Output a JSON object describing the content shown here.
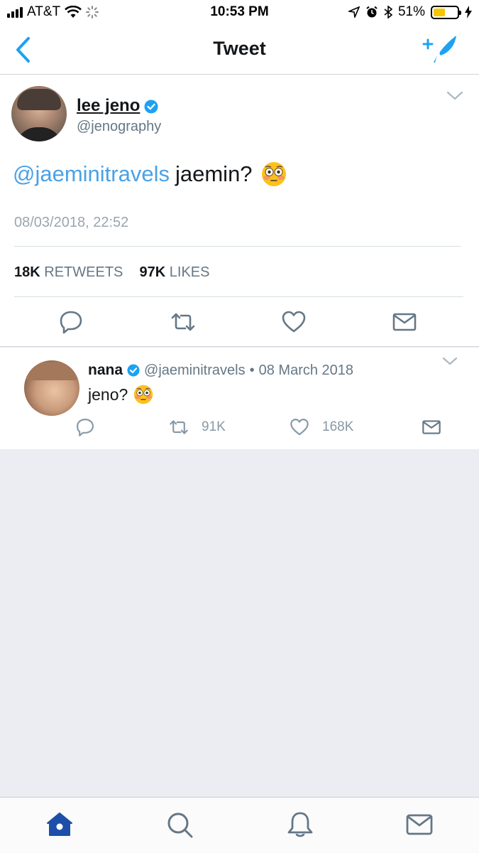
{
  "status_bar": {
    "carrier": "AT&T",
    "time": "10:53 PM",
    "battery_percent": "51%",
    "battery_level": 0.51,
    "battery_color": "#f7c600"
  },
  "nav": {
    "title": "Tweet",
    "back_icon": "chevron-left-icon",
    "compose_icon": "compose-tweet-icon"
  },
  "main_tweet": {
    "name": "lee jeno",
    "handle": "@jenography",
    "mention": "@jaeminitravels",
    "text": "jaemin?",
    "emoji": "flushed-face",
    "timestamp": "08/03/2018, 22:52",
    "retweets_count": "18K",
    "retweets_label": "RETWEETS",
    "likes_count": "97K",
    "likes_label": "LIKES",
    "verified": true
  },
  "reply_tweet": {
    "name": "nana",
    "handle": "@jaeminitravels",
    "separator": "•",
    "date": "08 March 2018",
    "text": "jeno?",
    "emoji": "flushed-face",
    "retweets": "91K",
    "likes": "168K",
    "verified": true
  },
  "tab_bar": {
    "items": [
      "home",
      "search",
      "notifications",
      "messages"
    ],
    "active": "home"
  },
  "colors": {
    "accent": "#1da1f2",
    "mention": "#4aa1e6",
    "muted": "#657786",
    "tab_active": "#1d4fa8",
    "background": "#ebedf2"
  }
}
